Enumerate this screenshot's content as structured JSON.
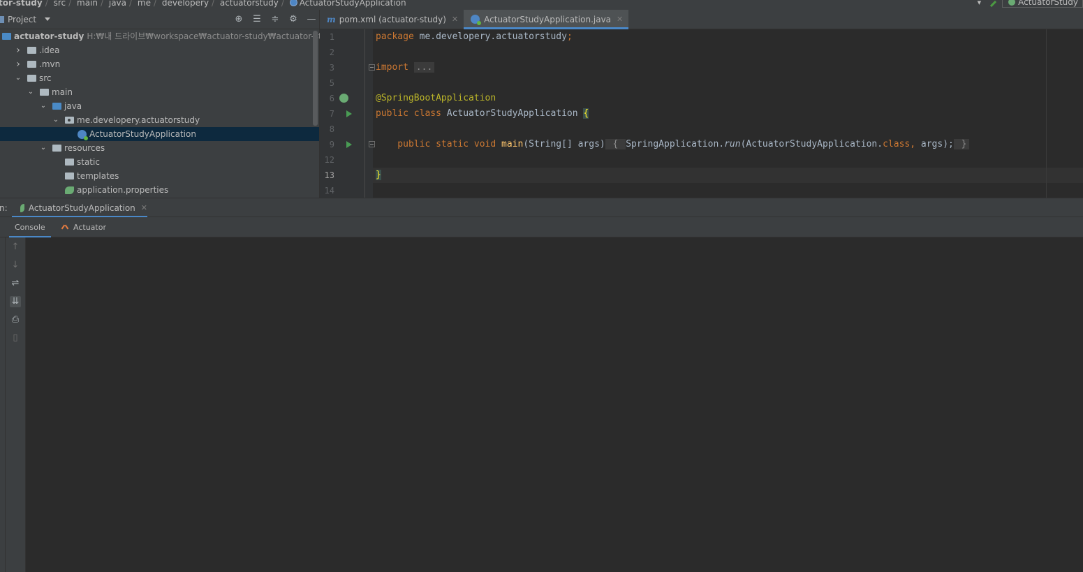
{
  "breadcrumb": {
    "items": [
      "tor-study",
      "src",
      "main",
      "java",
      "me",
      "developery",
      "actuatorstudy",
      "ActuatorStudyApplication"
    ]
  },
  "toolbar": {
    "run_config": "ActuatorStudy"
  },
  "project": {
    "title": "Project",
    "tree": [
      {
        "label": "actuator-study",
        "path": "H:₩내 드라이브₩workspace₩actuator-study₩actuator-study",
        "bold": true,
        "indent": 0,
        "arrow": "",
        "icon": "module"
      },
      {
        "label": ".idea",
        "indent": 1,
        "arrow": "right",
        "icon": "folder"
      },
      {
        "label": ".mvn",
        "indent": 1,
        "arrow": "right",
        "icon": "folder"
      },
      {
        "label": "src",
        "indent": 1,
        "arrow": "down",
        "icon": "folder"
      },
      {
        "label": "main",
        "indent": 2,
        "arrow": "down",
        "icon": "folder"
      },
      {
        "label": "java",
        "indent": 3,
        "arrow": "down",
        "icon": "folder-blue"
      },
      {
        "label": "me.developery.actuatorstudy",
        "indent": 4,
        "arrow": "down",
        "icon": "package"
      },
      {
        "label": "ActuatorStudyApplication",
        "indent": 5,
        "arrow": "",
        "icon": "spring-class",
        "selected": true
      },
      {
        "label": "resources",
        "indent": 3,
        "arrow": "down",
        "icon": "resources"
      },
      {
        "label": "static",
        "indent": 4,
        "arrow": "",
        "icon": "folder"
      },
      {
        "label": "templates",
        "indent": 4,
        "arrow": "",
        "icon": "folder"
      },
      {
        "label": "application.properties",
        "indent": 4,
        "arrow": "",
        "icon": "spring-properties"
      }
    ]
  },
  "editor": {
    "tabs": [
      {
        "label": "pom.xml (actuator-study)",
        "active": false,
        "icon": "maven"
      },
      {
        "label": "ActuatorStudyApplication.java",
        "active": true,
        "icon": "spring-class"
      }
    ],
    "line_numbers": [
      "1",
      "2",
      "3",
      "5",
      "6",
      "7",
      "8",
      "9",
      "12",
      "13",
      "14"
    ],
    "code": {
      "l1_kw": "package",
      "l1_rest": " me.developery.actuatorstudy",
      "l1_semi": ";",
      "l3_kw": "import",
      "l3_fold": "...",
      "l6_ann": "@SpringBootApplication",
      "l7_kw": "public class",
      "l7_name": " ActuatorStudyApplication ",
      "l7_brace": "{",
      "l9_kw": "    public static void",
      "l9_fn": " main",
      "l9_params": "(String[] args)",
      "l9_open": " { ",
      "l9_call": "SpringApplication.",
      "l9_run": "run",
      "l9_args": "(ActuatorStudyApplication.",
      "l9_class": "class",
      "l9_comma": ", ",
      "l9_args2": "args);",
      "l9_close": " }",
      "l13_brace": "}"
    }
  },
  "run": {
    "label": "n:",
    "tab": "ActuatorStudyApplication",
    "subtabs": [
      "Console",
      "Actuator"
    ]
  },
  "colors": {
    "accent": "#4a88c7",
    "keyword": "#cc7832",
    "annotation": "#bbb529",
    "function": "#ffc66d",
    "spring": "#6aab73"
  }
}
